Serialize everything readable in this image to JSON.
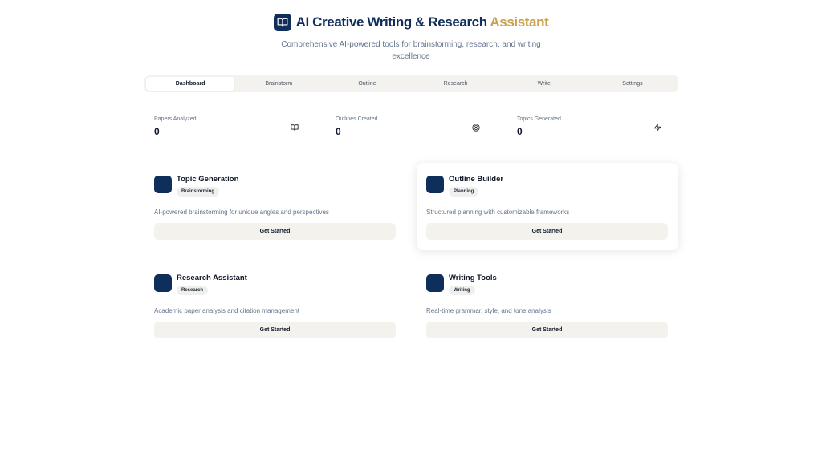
{
  "header": {
    "title_main": "AI Creative Writing & Research",
    "title_accent": "Assistant",
    "subtitle": "Comprehensive AI-powered tools for brainstorming, research, and writing excellence",
    "logo_icon": "book-open-icon",
    "brand_color": "#102e5c",
    "accent_color": "#c8a14e"
  },
  "tabs": [
    {
      "label": "Dashboard",
      "active": true
    },
    {
      "label": "Brainstorm"
    },
    {
      "label": "Outline"
    },
    {
      "label": "Research"
    },
    {
      "label": "Write"
    },
    {
      "label": "Settings"
    }
  ],
  "stats": [
    {
      "label": "Papers Analyzed",
      "value": "0",
      "icon": "book-open-icon"
    },
    {
      "label": "Outlines Created",
      "value": "0",
      "icon": "target-icon"
    },
    {
      "label": "Topics Generated",
      "value": "0",
      "icon": "zap-icon"
    }
  ],
  "cards": [
    {
      "title": "Topic Generation",
      "badge": "Brainstorming",
      "description": "AI-powered brainstorming for unique angles and perspectives",
      "button": "Get Started"
    },
    {
      "title": "Outline Builder",
      "badge": "Planning",
      "description": "Structured planning with customizable frameworks",
      "button": "Get Started"
    },
    {
      "title": "Research Assistant",
      "badge": "Research",
      "description": "Academic paper analysis and citation management",
      "button": "Get Started"
    },
    {
      "title": "Writing Tools",
      "badge": "Writing",
      "description": "Real-time grammar, style, and tone analysis",
      "button": "Get Started"
    }
  ]
}
